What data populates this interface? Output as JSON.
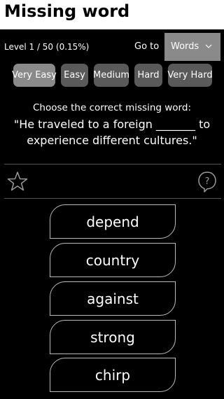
{
  "header": {
    "title": "Missing word"
  },
  "level": {
    "text": "Level 1 / 50 (0.15%)",
    "goto_label": "Go to",
    "select_value": "Words"
  },
  "difficulty": {
    "buttons": [
      {
        "label": "Very Easy",
        "active": true
      },
      {
        "label": "Easy",
        "active": false
      },
      {
        "label": "Medium",
        "active": false
      },
      {
        "label": "Hard",
        "active": false
      },
      {
        "label": "Very Hard",
        "active": false
      }
    ]
  },
  "question": {
    "prompt": "Choose the correct missing word:",
    "sentence": "\"He traveled to a foreign _______ to experience different cultures.\""
  },
  "icons": {
    "favorite": "star-icon",
    "help": "question-bubble-icon"
  },
  "answers": [
    {
      "label": "depend"
    },
    {
      "label": "country"
    },
    {
      "label": "against"
    },
    {
      "label": "strong"
    },
    {
      "label": "chirp"
    }
  ],
  "colors": {
    "background": "#000000",
    "titlebar": "#ffffff",
    "select_bg": "#8a8a8a",
    "button_active": "#8a8a8a",
    "button_inactive": "#5a5a5a",
    "answer_border": "#bbbbbb"
  }
}
